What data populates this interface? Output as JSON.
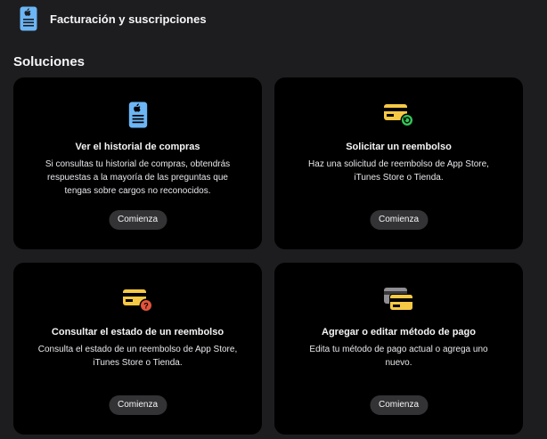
{
  "header": {
    "title": "Facturación y suscripciones",
    "icon": "receipt-icon"
  },
  "section": {
    "title": "Soluciones"
  },
  "cards": [
    {
      "title": "Ver el historial de compras",
      "description": "Si consultas tu historial de compras, obtendrás respuestas a la mayoría de las preguntas que tengas sobre cargos no reconocidos.",
      "button": "Comienza",
      "icon": "receipt-icon"
    },
    {
      "title": "Solicitar un reembolso",
      "description": "Haz una solicitud de reembolso de App Store, iTunes Store o Tienda.",
      "button": "Comienza",
      "icon": "card-refund-icon"
    },
    {
      "title": "Consultar el estado de un reembolso",
      "description": "Consulta el estado de un reembolso de App Store, iTunes Store o Tienda.",
      "button": "Comienza",
      "icon": "card-question-icon"
    },
    {
      "title": "Agregar o editar método de pago",
      "description": "Edita tu método de pago actual o agrega uno nuevo.",
      "button": "Comienza",
      "icon": "stacked-cards-icon"
    }
  ],
  "colors": {
    "background": "#1d1d1f",
    "card": "#000000",
    "button": "#333336",
    "receipt_blue": "#6cb6f5",
    "card_yellow": "#f6c945",
    "refund_green": "#34c759",
    "question_red": "#e2543b"
  }
}
